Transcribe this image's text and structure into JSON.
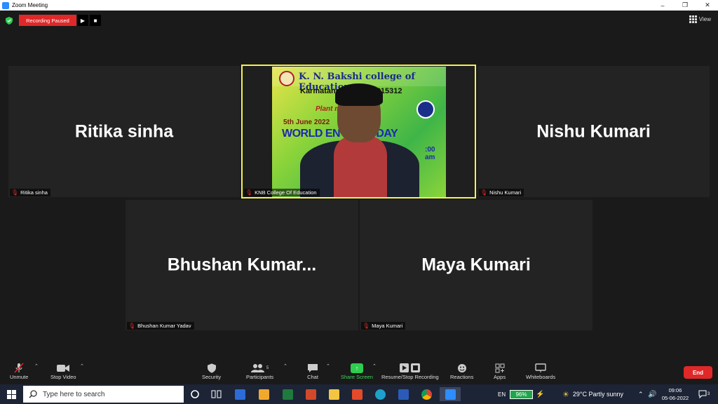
{
  "window": {
    "title": "Zoom Meeting",
    "minimize_glyph": "–",
    "restore_glyph": "❐",
    "close_glyph": "✕"
  },
  "recording": {
    "status": "Recording Paused",
    "resume_glyph": "▶",
    "stop_glyph": "■"
  },
  "view": {
    "label": "View"
  },
  "participants": [
    {
      "big_name": "Ritika sinha",
      "nameplate": "Ritika sinha",
      "muted": true
    },
    {
      "big_name": "",
      "nameplate": "KNB College Of Education",
      "muted": true,
      "active_speaker": true
    },
    {
      "big_name": "Nishu Kumari",
      "nameplate": "Nishu Kumari",
      "muted": true
    },
    {
      "big_name": "Bhushan  Kumar...",
      "nameplate": "Bhushan Kumar Yadav",
      "muted": true
    },
    {
      "big_name": "Maya Kumari",
      "nameplate": "Maya Kumari",
      "muted": true
    }
  ],
  "video_banner": {
    "college": "K. N. Bakshi college of Education",
    "address": "Karmatand,              Giridih - 815312",
    "program": "Plant              mme",
    "date": "5th June 2022",
    "headline": "WORLD EN         MENT DAY",
    "time": ":00 am"
  },
  "toolbar": {
    "unmute": "Unmute",
    "stop_video": "Stop Video",
    "security": "Security",
    "participants": "Participants",
    "participants_count": "5",
    "chat": "Chat",
    "share_screen": "Share Screen",
    "recording": "Resume/Stop Recording",
    "reactions": "Reactions",
    "apps": "Apps",
    "whiteboards": "Whiteboards",
    "end": "End"
  },
  "taskbar": {
    "search_placeholder": "Type here to search",
    "language": "EN",
    "battery": "96%",
    "weather": "29°C  Partly sunny",
    "time": "09:06",
    "date": "05-06-2022",
    "notifications": "3"
  },
  "colors": {
    "accent_red": "#e02828",
    "active_border": "#f5f252",
    "share_green": "#2ecc4f",
    "taskbar": "#1c2436"
  }
}
